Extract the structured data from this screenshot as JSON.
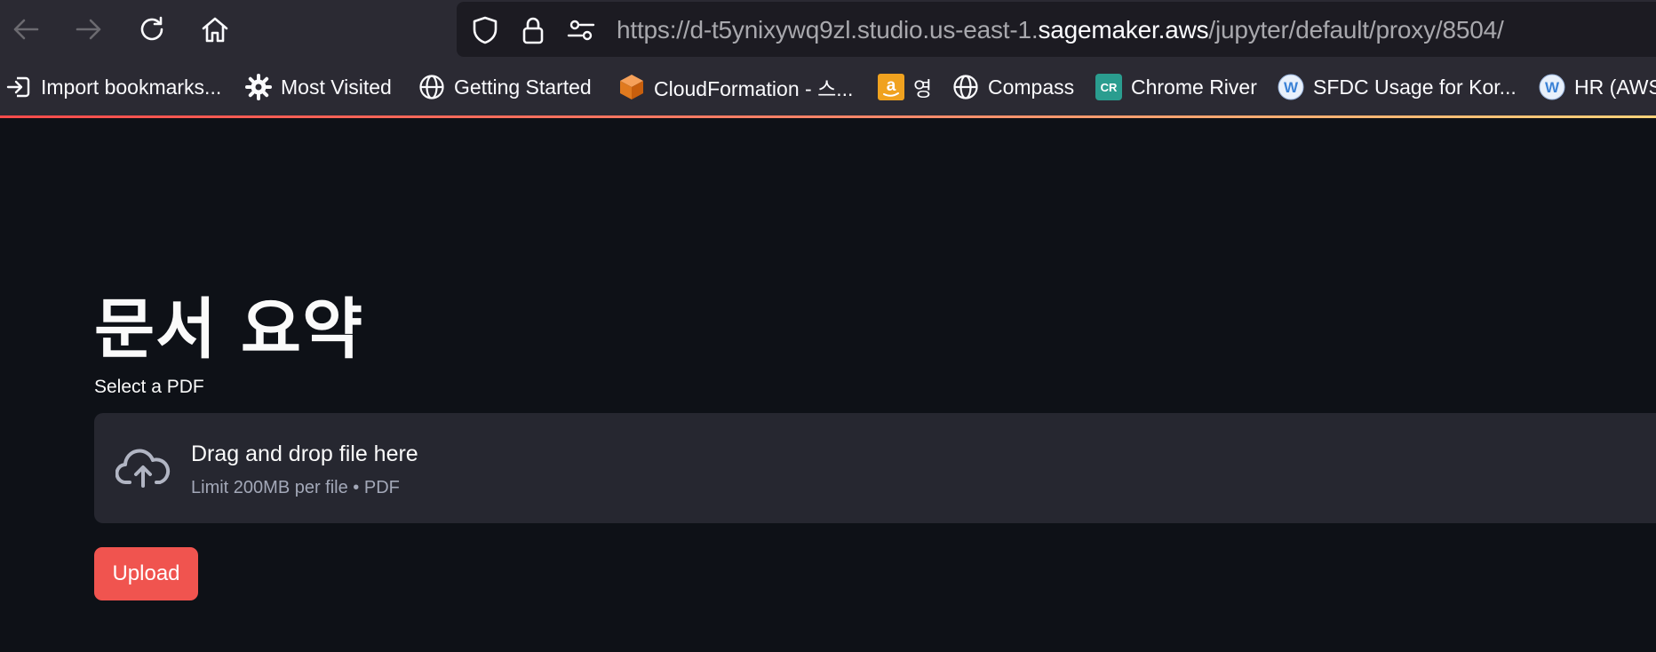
{
  "browser": {
    "nav": {
      "back_icon": "arrow-left-icon",
      "forward_icon": "arrow-right-icon",
      "reload_icon": "reload-icon",
      "home_icon": "home-icon"
    },
    "url": {
      "prefix": "https://d-t5ynixywq9zl.studio.us-east-1.",
      "host": "sagemaker.aws",
      "path": "/jupyter/default/proxy/8504/",
      "icons": [
        "shield-icon",
        "lock-icon",
        "permissions-icon"
      ]
    },
    "bookmarks": [
      {
        "label": "Import bookmarks...",
        "icon": "import-icon"
      },
      {
        "label": "Most Visited",
        "icon": "gear-icon"
      },
      {
        "label": "Getting Started",
        "icon": "globe-icon"
      },
      {
        "label": "CloudFormation - 스...",
        "icon": "cloudformation-cube-icon"
      },
      {
        "label": "영",
        "icon": "amazon-icon"
      },
      {
        "label": "Compass",
        "icon": "globe-icon"
      },
      {
        "label": "Chrome River",
        "icon": "chrome-river-icon"
      },
      {
        "label": "SFDC Usage for Kor...",
        "icon": "wiki-w-icon"
      },
      {
        "label": "HR (AWS",
        "icon": "wiki-w-icon"
      }
    ]
  },
  "app": {
    "title": "문서 요약",
    "uploader": {
      "label": "Select a PDF",
      "drop_text": "Drag and drop file here",
      "limit_text": "Limit 200MB per file • PDF",
      "icon": "cloud-upload-icon"
    },
    "upload_button": "Upload"
  },
  "colors": {
    "chrome_bg": "#2b2a33",
    "urlbar_bg": "#1c1b22",
    "app_bg": "#0e1117",
    "dropzone_bg": "#262730",
    "primary": "#f0544f"
  }
}
